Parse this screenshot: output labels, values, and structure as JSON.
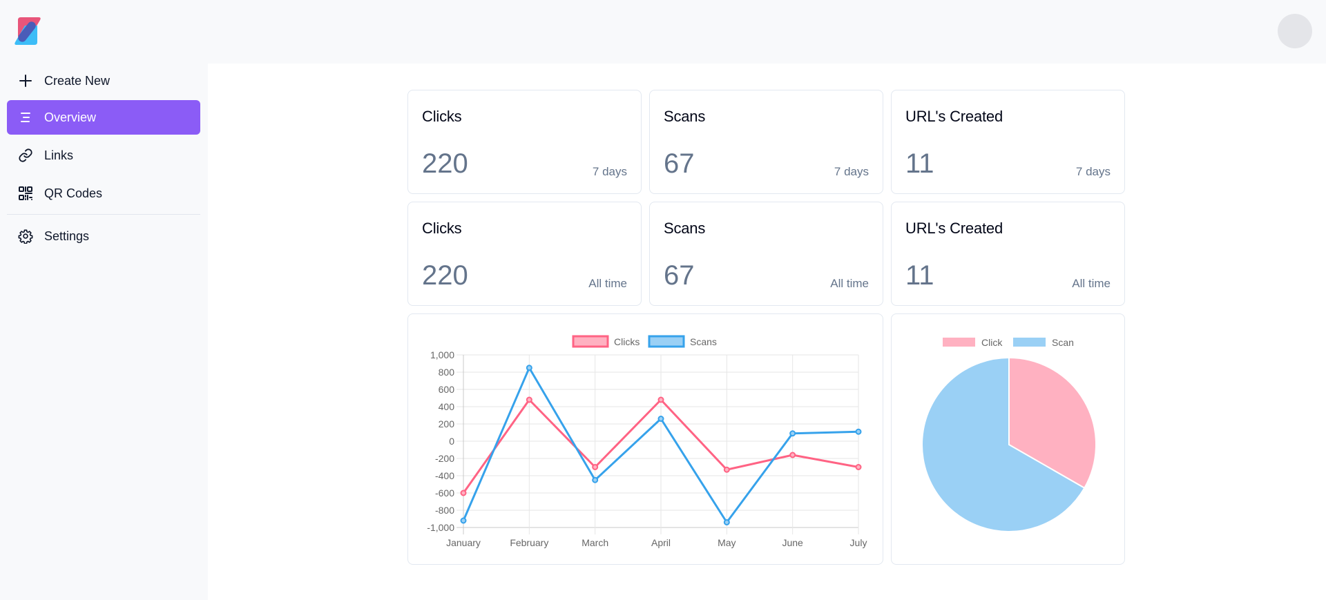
{
  "header": {
    "logo_alt": "App logo",
    "avatar": "user-avatar"
  },
  "sidebar": {
    "items": [
      {
        "label": "Create New",
        "icon": "plus-icon",
        "active": false
      },
      {
        "label": "Overview",
        "icon": "overview-icon",
        "active": true
      },
      {
        "label": "Links",
        "icon": "link-icon",
        "active": false
      },
      {
        "label": "QR Codes",
        "icon": "qr-code-icon",
        "active": false
      },
      {
        "label": "Settings",
        "icon": "gear-icon",
        "active": false
      }
    ],
    "active_color": "#8b5cf6"
  },
  "stats": [
    {
      "title": "Clicks",
      "value": "220",
      "period": "7 days"
    },
    {
      "title": "Scans",
      "value": "67",
      "period": "7 days"
    },
    {
      "title": "URL's Created",
      "value": "11",
      "period": "7 days"
    },
    {
      "title": "Clicks",
      "value": "220",
      "period": "All time"
    },
    {
      "title": "Scans",
      "value": "67",
      "period": "All time"
    },
    {
      "title": "URL's Created",
      "value": "11",
      "period": "All time"
    }
  ],
  "chart_data": [
    {
      "type": "line",
      "title": "",
      "xlabel": "",
      "ylabel": "",
      "categories": [
        "January",
        "February",
        "March",
        "April",
        "May",
        "June",
        "July"
      ],
      "ylim": [
        -1000,
        1000
      ],
      "yticks": [
        1000,
        800,
        600,
        400,
        200,
        0,
        -200,
        -400,
        -600,
        -800,
        -1000
      ],
      "ytick_labels": [
        "1,000",
        "800",
        "600",
        "400",
        "200",
        "0",
        "-200",
        "-400",
        "-600",
        "-800",
        "-1,000"
      ],
      "grid": true,
      "legend": "top-center",
      "series": [
        {
          "name": "Clicks",
          "color": "#ff6384",
          "fill": "#ffb1c1",
          "values": [
            -600,
            480,
            -300,
            480,
            -330,
            -160,
            -300
          ]
        },
        {
          "name": "Scans",
          "color": "#36a2eb",
          "fill": "#9ad0f5",
          "values": [
            -920,
            850,
            -450,
            260,
            -940,
            90,
            110
          ]
        }
      ]
    },
    {
      "type": "pie",
      "title": "",
      "legend": "top-center",
      "labels": [
        "Click",
        "Scan"
      ],
      "values": [
        33.3,
        66.7
      ],
      "colors": [
        "#ffb1c1",
        "#9ad0f5"
      ]
    }
  ]
}
